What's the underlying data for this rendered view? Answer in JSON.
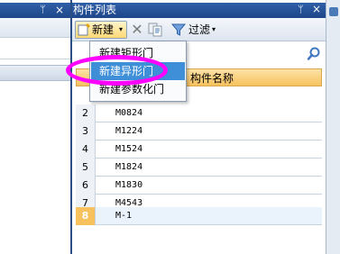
{
  "right_panel": {
    "title": "构件列表",
    "pin_glyph": "ᛘ",
    "close_glyph": "×"
  },
  "left_panel": {
    "pin_glyph": "ᛘ",
    "close_glyph": "×"
  },
  "toolbar": {
    "new_label": "新建",
    "filter_label": "过滤",
    "dropdown_caret": "▾",
    "delete_glyph": "✕"
  },
  "new_menu": {
    "items": [
      {
        "label": "新建矩形门"
      },
      {
        "label": "新建异形门"
      },
      {
        "label": "新建参数化门"
      }
    ],
    "highlighted_index": 1
  },
  "table": {
    "header": {
      "name": "构件名称"
    },
    "rows": [
      {
        "num": "2",
        "name": "M0824"
      },
      {
        "num": "3",
        "name": "M1224"
      },
      {
        "num": "4",
        "name": "M1524"
      },
      {
        "num": "5",
        "name": "M1824"
      },
      {
        "num": "6",
        "name": "M1830"
      },
      {
        "num": "7",
        "name": "M4543"
      },
      {
        "num": "8",
        "name": "M-1"
      }
    ],
    "selected_num": "8"
  },
  "colors": {
    "titlebar": "#2f5fa8",
    "header": "#f7c15e",
    "menu_highlight": "#3f8fd8",
    "annotation_ring": "#ff00ff"
  }
}
